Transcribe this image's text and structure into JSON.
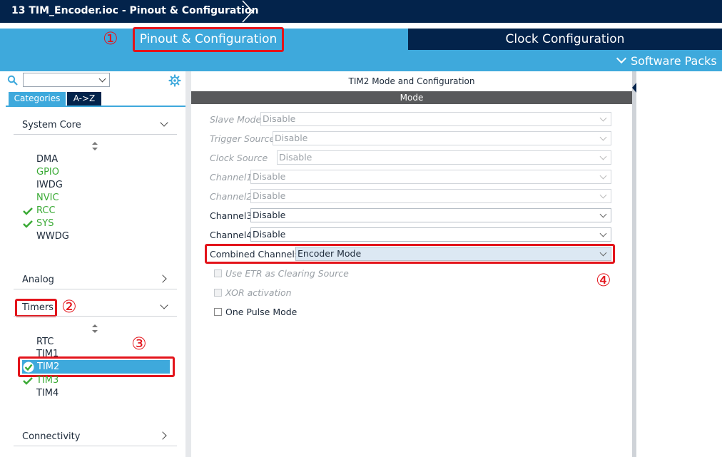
{
  "window": {
    "title": "13 TIM_Encoder.ioc - Pinout & Configuration"
  },
  "tabs": {
    "pinout": "Pinout & Configuration",
    "clock": "Clock Configuration",
    "software_packs": "Software Packs"
  },
  "annotations": {
    "n1": "①",
    "n2": "②",
    "n3": "③",
    "n4": "④"
  },
  "colors": {
    "titlebar": "#03234b",
    "accent": "#3ea9dc",
    "callout": "#e3141b",
    "enabled_green": "#3aaa35"
  },
  "sidebar": {
    "tabs": {
      "categories": "Categories",
      "atoz": "A->Z"
    },
    "sections": {
      "system_core": "System Core",
      "analog": "Analog",
      "timers": "Timers",
      "connectivity": "Connectivity"
    },
    "system_core_items": {
      "dma": "DMA",
      "gpio": "GPIO",
      "iwdg": "IWDG",
      "nvic": "NVIC",
      "rcc": "RCC",
      "sys": "SYS",
      "wwdg": "WWDG"
    },
    "timer_items": {
      "rtc": "RTC",
      "tim1": "TIM1",
      "tim2": "TIM2",
      "tim3": "TIM3",
      "tim4": "TIM4"
    }
  },
  "main": {
    "title": "TIM2 Mode and Configuration",
    "band": "Mode",
    "fields": {
      "slave_mode": {
        "label": "Slave Mode",
        "value": "Disable"
      },
      "trigger_source": {
        "label": "Trigger Source",
        "value": "Disable"
      },
      "clock_source": {
        "label": "Clock Source",
        "value": "Disable"
      },
      "channel1": {
        "label": "Channel1",
        "value": "Disable"
      },
      "channel2": {
        "label": "Channel2",
        "value": "Disable"
      },
      "channel3": {
        "label": "Channel3",
        "value": "Disable"
      },
      "channel4": {
        "label": "Channel4",
        "value": "Disable"
      },
      "combined": {
        "label": "Combined Channels",
        "value": "Encoder Mode"
      }
    },
    "checkboxes": {
      "use_etr": "Use ETR as Clearing Source",
      "xor": "XOR activation",
      "one_pulse": "One Pulse Mode"
    }
  }
}
